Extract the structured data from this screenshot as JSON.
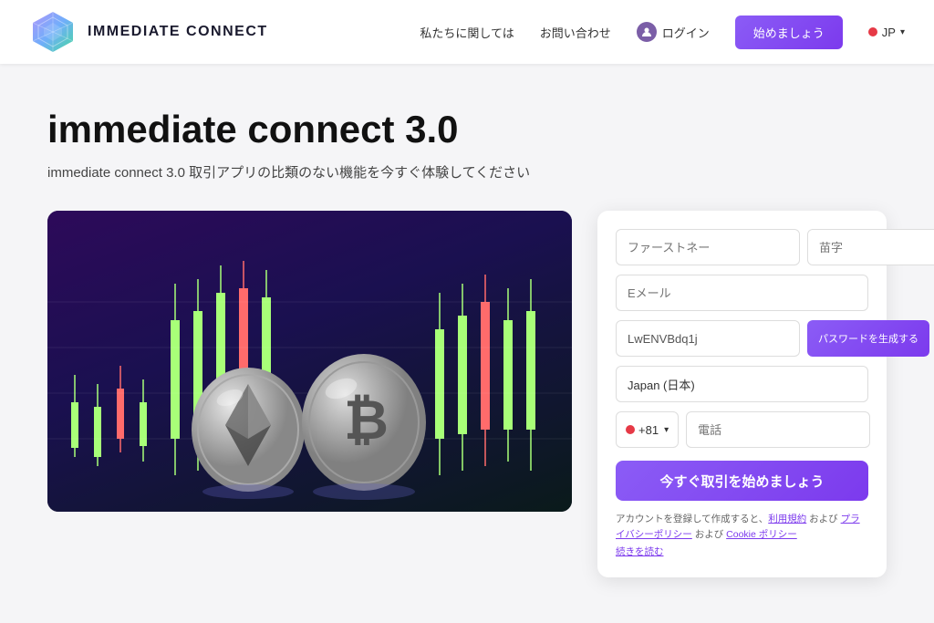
{
  "header": {
    "brand": "IMMEDIATE CONNECT",
    "nav": {
      "about": "私たちに関しては",
      "contact": "お問い合わせ",
      "login": "ログイン",
      "start": "始めましょう",
      "lang": "JP"
    }
  },
  "hero": {
    "title": "immediate connect 3.0",
    "subtitle": "immediate connect 3.0 取引アプリの比類のない機能を今すぐ体験してください"
  },
  "form": {
    "first_name_placeholder": "ファーストネー",
    "last_name_placeholder": "苗字",
    "email_placeholder": "Eメール",
    "password_value": "LwENVBdq1j",
    "password_btn": "パスワードを生成する",
    "country_value": "Japan (日本)",
    "phone_prefix": "+81",
    "phone_placeholder": "電話",
    "submit": "今すぐ取引を始めましょう",
    "disclaimer": "アカウントを登録して作成すると、利用規約 および プライバシーポリシー および Cookie ポリシー",
    "disclaimer_link1": "利用規約",
    "disclaimer_link2": "プライバシーポリシー",
    "disclaimer_link3": "Cookie ポリシー",
    "read_more": "続きを読む"
  }
}
